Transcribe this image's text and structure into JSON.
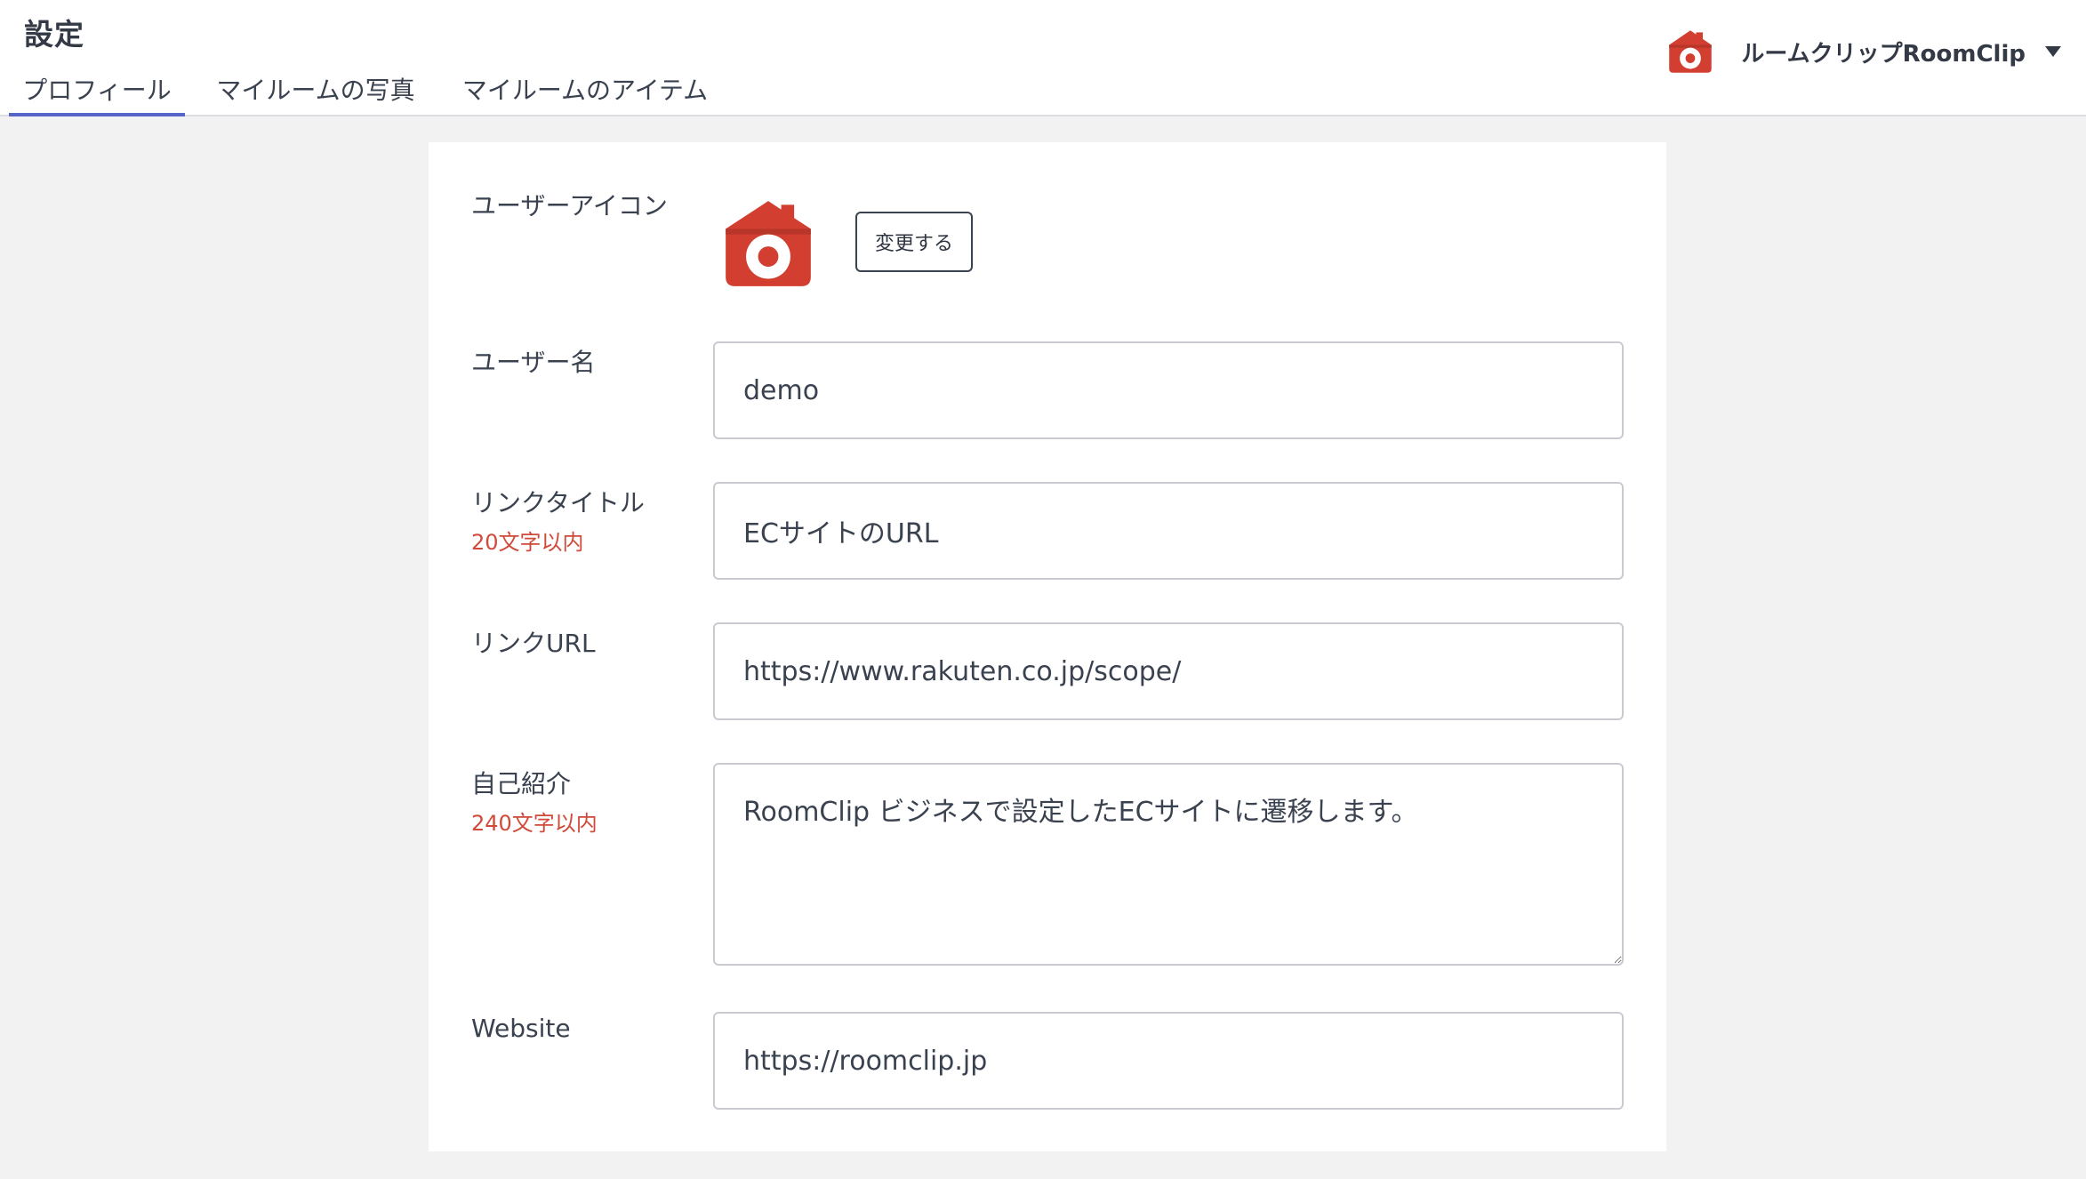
{
  "header": {
    "title": "設定",
    "tabs": [
      {
        "label": "プロフィール",
        "active": true
      },
      {
        "label": "マイルームの写真",
        "active": false
      },
      {
        "label": "マイルームのアイテム",
        "active": false
      }
    ],
    "account": {
      "name": "ルームクリップRoomClip",
      "avatar_icon": "roomclip-house-camera-icon",
      "menu_icon": "caret-down-icon"
    }
  },
  "form": {
    "user_icon": {
      "label": "ユーザーアイコン",
      "icon": "roomclip-house-camera-icon",
      "change_button": "変更する"
    },
    "username": {
      "label": "ユーザー名",
      "value": "demo"
    },
    "link_title": {
      "label": "リンクタイトル",
      "note": "20文字以内",
      "value": "ECサイトのURL"
    },
    "link_url": {
      "label": "リンクURL",
      "value": "https://www.rakuten.co.jp/scope/"
    },
    "bio": {
      "label": "自己紹介",
      "note": "240文字以内",
      "value": "RoomClip ビジネスで設定したECサイトに遷移します。"
    },
    "website": {
      "label": "Website",
      "value": "https://roomclip.jp"
    }
  },
  "colors": {
    "brand_red": "#d23f31",
    "tab_active": "#5865c8",
    "note_red": "#d04a3a",
    "background": "#f2f2f3"
  }
}
